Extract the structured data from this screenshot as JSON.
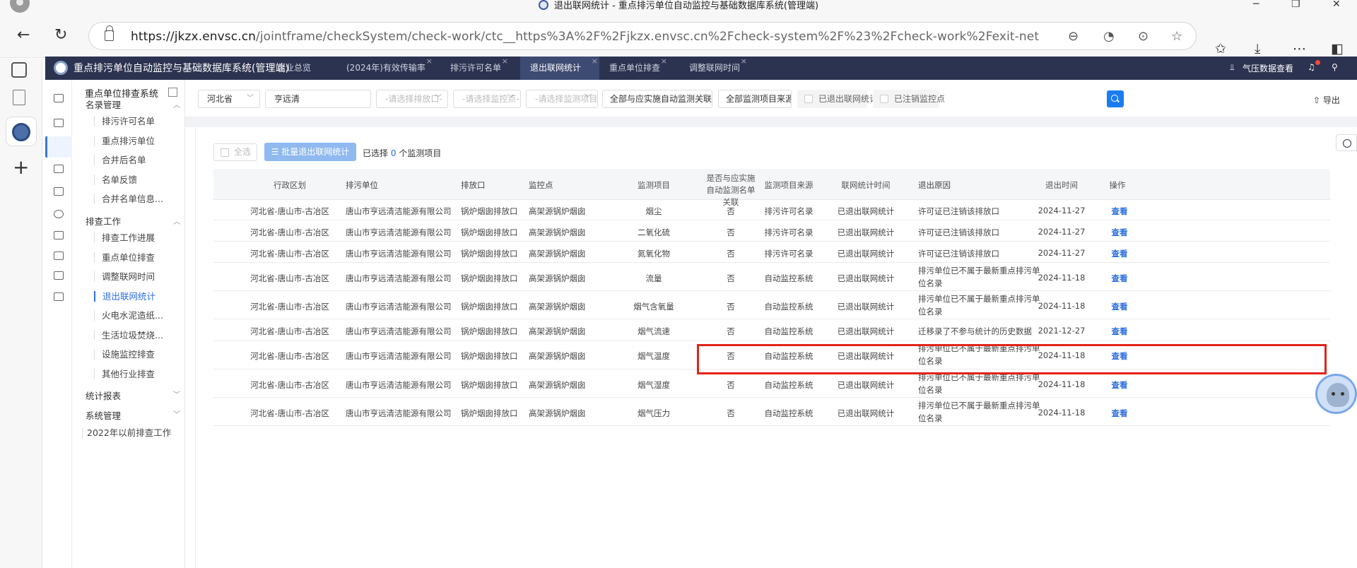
{
  "browser": {
    "window_title": "退出联网统计 - 重点排污单位自动监控与基础数据库系统(管理端)",
    "url_host": "https://jkzx.envsc.cn",
    "url_path": "/jointframe/checkSystem/check-work/ctc__https%3A%2F%2Fjkzx.envsc.cn%2Fcheck-system%2F%23%2Fcheck-work%2Fexit-net"
  },
  "app": {
    "brand": "重点排污单位自动监控与基础数据库系统(管理端)",
    "tabs": [
      "企业总览",
      "(2024年)有效传输率",
      "排污许可名单",
      "退出联网统计",
      "重点单位排查",
      "调整联网时间"
    ],
    "right_label": "气压数据查看"
  },
  "sidebar": {
    "title": "重点单位排查系统",
    "groups": [
      {
        "label": "名录管理",
        "items": [
          "排污许可名单",
          "重点排污单位",
          "合并后名单",
          "名单反馈",
          "合并名单信息..."
        ]
      },
      {
        "label": "排查工作",
        "items": [
          "排查工作进展",
          "重点单位排查",
          "调整联网时间",
          "退出联网统计",
          "火电水泥造纸...",
          "生活垃圾焚烧...",
          "设施监控排查",
          "其他行业排查"
        ]
      },
      {
        "label": "统计报表",
        "items": []
      },
      {
        "label": "系统管理",
        "items": []
      }
    ],
    "footer_item": "2022年以前排查工作"
  },
  "filters": {
    "province": "河北省",
    "company": "亨远清",
    "outlet_placeholder": "-请选择排放口-",
    "point_placeholder": "-请选择监控点-",
    "item_placeholder": "-请选择监测项目-",
    "relation": "全部与应实施自动监测关联情况",
    "source": "全部监测项目来源",
    "chk_exited": "已退出联网统计",
    "chk_cancelled": "已注销监控点",
    "export": "导出"
  },
  "actions": {
    "select_all": "全选",
    "batch_exit": "批量退出联网统计",
    "selected_prefix": "已选择",
    "selected_count": "0",
    "selected_suffix": "个监测项目"
  },
  "table": {
    "headers": [
      "行政区划",
      "排污单位",
      "排放口",
      "监控点",
      "监测项目",
      "是否与应实施自动监测名单关联",
      "监测项目来源",
      "联网统计时间",
      "退出原因",
      "退出时间",
      "操作"
    ],
    "rows": [
      {
        "region": "河北省-唐山市-古冶区",
        "company": "唐山市亨远清洁能源有限公司",
        "outlet": "锅炉烟囱排放口",
        "point": "高架源锅炉烟囱",
        "item": "烟尘",
        "linked": "否",
        "source": "排污许可名录",
        "status": "已退出联网统计",
        "reason": "许可证已注销该排放口",
        "date": "2024-11-27",
        "op": "查看"
      },
      {
        "region": "河北省-唐山市-古冶区",
        "company": "唐山市亨远清洁能源有限公司",
        "outlet": "锅炉烟囱排放口",
        "point": "高架源锅炉烟囱",
        "item": "二氧化硫",
        "linked": "否",
        "source": "排污许可名录",
        "status": "已退出联网统计",
        "reason": "许可证已注销该排放口",
        "date": "2024-11-27",
        "op": "查看"
      },
      {
        "region": "河北省-唐山市-古冶区",
        "company": "唐山市亨远清洁能源有限公司",
        "outlet": "锅炉烟囱排放口",
        "point": "高架源锅炉烟囱",
        "item": "氮氧化物",
        "linked": "否",
        "source": "排污许可名录",
        "status": "已退出联网统计",
        "reason": "许可证已注销该排放口",
        "date": "2024-11-27",
        "op": "查看"
      },
      {
        "region": "河北省-唐山市-古冶区",
        "company": "唐山市亨远清洁能源有限公司",
        "outlet": "锅炉烟囱排放口",
        "point": "高架源锅炉烟囱",
        "item": "流量",
        "linked": "否",
        "source": "自动监控系统",
        "status": "已退出联网统计",
        "reason": "排污单位已不属于最新重点排污单位名录",
        "date": "2024-11-18",
        "op": "查看"
      },
      {
        "region": "河北省-唐山市-古冶区",
        "company": "唐山市亨远清洁能源有限公司",
        "outlet": "锅炉烟囱排放口",
        "point": "高架源锅炉烟囱",
        "item": "烟气含氧量",
        "linked": "否",
        "source": "自动监控系统",
        "status": "已退出联网统计",
        "reason": "排污单位已不属于最新重点排污单位名录",
        "date": "2024-11-18",
        "op": "查看"
      },
      {
        "region": "河北省-唐山市-古冶区",
        "company": "唐山市亨远清洁能源有限公司",
        "outlet": "锅炉烟囱排放口",
        "point": "高架源锅炉烟囱",
        "item": "烟气流速",
        "linked": "否",
        "source": "自动监控系统",
        "status": "已退出联网统计",
        "reason": "迁移录了不参与统计的历史数据",
        "date": "2021-12-27",
        "op": "查看"
      },
      {
        "region": "河北省-唐山市-古冶区",
        "company": "唐山市亨远清洁能源有限公司",
        "outlet": "锅炉烟囱排放口",
        "point": "高架源锅炉烟囱",
        "item": "烟气温度",
        "linked": "否",
        "source": "自动监控系统",
        "status": "已退出联网统计",
        "reason": "排污单位已不属于最新重点排污单位名录",
        "date": "2024-11-18",
        "op": "查看"
      },
      {
        "region": "河北省-唐山市-古冶区",
        "company": "唐山市亨远清洁能源有限公司",
        "outlet": "锅炉烟囱排放口",
        "point": "高架源锅炉烟囱",
        "item": "烟气湿度",
        "linked": "否",
        "source": "自动监控系统",
        "status": "已退出联网统计",
        "reason": "排污单位已不属于最新重点排污单位名录",
        "date": "2024-11-18",
        "op": "查看"
      },
      {
        "region": "河北省-唐山市-古冶区",
        "company": "唐山市亨远清洁能源有限公司",
        "outlet": "锅炉烟囱排放口",
        "point": "高架源锅炉烟囱",
        "item": "烟气压力",
        "linked": "否",
        "source": "自动监控系统",
        "status": "已退出联网统计",
        "reason": "排污单位已不属于最新重点排污单位名录",
        "date": "2024-11-18",
        "op": "查看"
      }
    ]
  },
  "colors": {
    "header_bg": "#2c3350",
    "accent": "#1b7cf1",
    "highlight": "#e2231a"
  }
}
